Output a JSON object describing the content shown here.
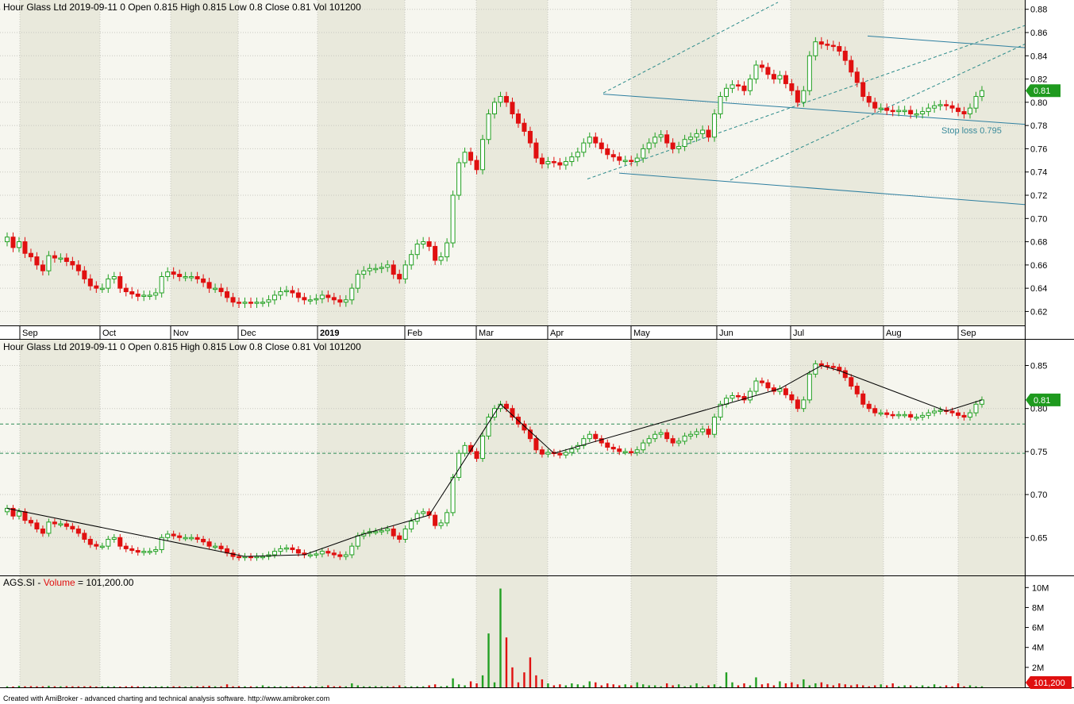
{
  "header": {
    "top": "Hour Glass Ltd   2019-09-11  0  Open 0.815  High 0.815  Low 0.8  Close 0.81  Vol 101200",
    "middle": "Hour Glass Ltd   2019-09-11  0  Open 0.815  High 0.815  Low 0.8  Close 0.81  Vol 101200",
    "volume_prefix": "AGS.SI - ",
    "volume_name": "Volume",
    "volume_suffix": " = 101,200.00"
  },
  "annotations": {
    "stop_loss": "Stop loss 0.795"
  },
  "footer": "Created with AmiBroker - advanced charting and technical analysis software. http://www.amibroker.com",
  "colors": {
    "up": "#22a022",
    "down": "#e01010",
    "channel": "#2a8a8a",
    "channel_line": "#2e7fa0",
    "zigzag": "#000000",
    "hline": "#2e8b57",
    "shade": "#e9e9dc",
    "plot_bg": "#f6f6ef"
  },
  "chart_data": [
    {
      "type": "candlestick",
      "title": "Hour Glass Ltd",
      "x_labels": [
        "Sep",
        "Oct",
        "Nov",
        "Dec",
        "2019",
        "Feb",
        "Mar",
        "Apr",
        "May",
        "Jun",
        "Jul",
        "Aug",
        "Sep"
      ],
      "y_ticks": [
        "0.88",
        "0.86",
        "0.84",
        "0.82",
        "0.80",
        "0.78",
        "0.76",
        "0.74",
        "0.72",
        "0.70",
        "0.68",
        "0.66",
        "0.64",
        "0.62"
      ],
      "ylim": [
        0.608,
        0.888
      ],
      "last_value_label": "0.81",
      "stop_loss": 0.795,
      "close": [
        0.684,
        0.675,
        0.68,
        0.67,
        0.667,
        0.66,
        0.655,
        0.668,
        0.666,
        0.666,
        0.663,
        0.66,
        0.655,
        0.648,
        0.642,
        0.64,
        0.64,
        0.648,
        0.65,
        0.64,
        0.637,
        0.635,
        0.633,
        0.634,
        0.634,
        0.636,
        0.65,
        0.654,
        0.652,
        0.65,
        0.65,
        0.65,
        0.648,
        0.645,
        0.64,
        0.64,
        0.637,
        0.632,
        0.628,
        0.627,
        0.628,
        0.627,
        0.628,
        0.628,
        0.63,
        0.634,
        0.637,
        0.638,
        0.636,
        0.632,
        0.63,
        0.63,
        0.631,
        0.634,
        0.632,
        0.63,
        0.628,
        0.63,
        0.64,
        0.652,
        0.655,
        0.657,
        0.657,
        0.658,
        0.66,
        0.652,
        0.648,
        0.66,
        0.669,
        0.678,
        0.68,
        0.676,
        0.664,
        0.667,
        0.679,
        0.72,
        0.748,
        0.757,
        0.75,
        0.742,
        0.768,
        0.79,
        0.8,
        0.805,
        0.8,
        0.79,
        0.782,
        0.775,
        0.765,
        0.752,
        0.747,
        0.749,
        0.748,
        0.746,
        0.749,
        0.753,
        0.757,
        0.765,
        0.77,
        0.765,
        0.76,
        0.755,
        0.753,
        0.75,
        0.75,
        0.749,
        0.752,
        0.76,
        0.765,
        0.77,
        0.772,
        0.765,
        0.76,
        0.762,
        0.768,
        0.77,
        0.773,
        0.776,
        0.77,
        0.79,
        0.805,
        0.812,
        0.815,
        0.814,
        0.81,
        0.82,
        0.832,
        0.83,
        0.824,
        0.82,
        0.823,
        0.816,
        0.81,
        0.8,
        0.81,
        0.84,
        0.852,
        0.85,
        0.849,
        0.848,
        0.844,
        0.836,
        0.826,
        0.817,
        0.805,
        0.8,
        0.795,
        0.795,
        0.793,
        0.792,
        0.793,
        0.793,
        0.79,
        0.79,
        0.792,
        0.795,
        0.797,
        0.798,
        0.797,
        0.795,
        0.792,
        0.79,
        0.795,
        0.805,
        0.81
      ],
      "high_low_source": "approximated from candle extents"
    },
    {
      "type": "candlestick",
      "title": "Hour Glass Ltd",
      "y_ticks": [
        "0.85",
        "0.80",
        "0.75",
        "0.70",
        "0.65"
      ],
      "ylim": [
        0.606,
        0.88
      ],
      "last_value_label": "0.81",
      "horizontal_levels": [
        0.782,
        0.748
      ]
    },
    {
      "type": "bar",
      "title": "AGS.SI - Volume = 101,200.00",
      "y_ticks": [
        "10M",
        "8M",
        "6M",
        "4M",
        "2M"
      ],
      "ylim": [
        0,
        10500000
      ],
      "last_value_label": "101,200",
      "values_approx_millions": [
        0.1,
        0.08,
        0.15,
        0.1,
        0.12,
        0.1,
        0.1,
        0.15,
        0.1,
        0.1,
        0.12,
        0.1,
        0.1,
        0.1,
        0.12,
        0.08,
        0.1,
        0.1,
        0.1,
        0.08,
        0.1,
        0.12,
        0.1,
        0.1,
        0.08,
        0.1,
        0.1,
        0.1,
        0.1,
        0.1,
        0.08,
        0.1,
        0.1,
        0.12,
        0.15,
        0.1,
        0.1,
        0.3,
        0.1,
        0.12,
        0.1,
        0.1,
        0.1,
        0.2,
        0.1,
        0.1,
        0.1,
        0.1,
        0.1,
        0.1,
        0.1,
        0.12,
        0.1,
        0.1,
        0.2,
        0.1,
        0.12,
        0.1,
        0.4,
        0.2,
        0.1,
        0.1,
        0.12,
        0.1,
        0.1,
        0.1,
        0.2,
        0.1,
        0.1,
        0.1,
        0.1,
        0.2,
        0.3,
        0.1,
        0.15,
        0.9,
        0.3,
        0.2,
        0.6,
        0.4,
        1.2,
        5.4,
        0.5,
        9.9,
        5.0,
        2.0,
        0.5,
        1.5,
        3.0,
        1.2,
        0.8,
        0.4,
        0.2,
        0.3,
        0.2,
        0.4,
        0.3,
        0.2,
        0.6,
        0.5,
        0.2,
        0.4,
        0.3,
        0.2,
        0.3,
        0.2,
        0.5,
        0.3,
        0.2,
        0.2,
        0.1,
        0.4,
        0.2,
        0.3,
        0.1,
        0.2,
        0.4,
        0.1,
        0.2,
        0.3,
        0.1,
        1.5,
        0.5,
        0.2,
        0.4,
        0.2,
        1.0,
        0.3,
        0.4,
        0.2,
        0.6,
        0.4,
        0.5,
        0.3,
        0.8,
        0.2,
        0.4,
        0.5,
        0.3,
        0.2,
        0.4,
        0.3,
        0.2,
        0.3,
        0.2,
        0.1,
        0.2,
        0.3,
        0.2,
        0.4,
        0.1,
        0.2,
        0.2,
        0.1,
        0.2,
        0.1,
        0.3,
        0.1,
        0.2,
        0.1,
        0.4,
        0.1,
        0.2,
        0.1,
        0.1
      ]
    }
  ]
}
